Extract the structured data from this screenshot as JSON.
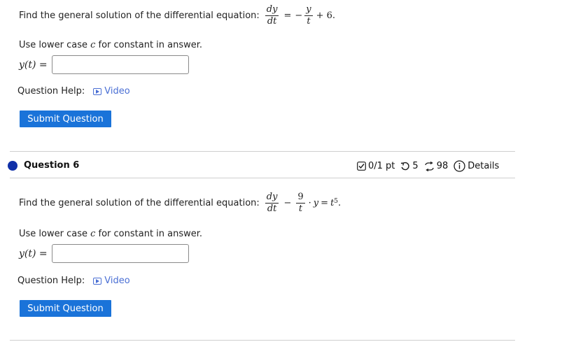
{
  "q5": {
    "prompt": "Find the general solution of the differential equation:",
    "eq": {
      "lhs_num": "dy",
      "lhs_den": "dt",
      "eq": "=",
      "neg": "−",
      "r_num": "y",
      "r_den": "t",
      "tail": "+ 6."
    },
    "instruction_pre": "Use lower case ",
    "instruction_var": "c",
    "instruction_post": " for constant in answer.",
    "answer_label": "y(t) =",
    "answer_value": "",
    "help_label": "Question Help:",
    "video_label": "Video",
    "submit_label": "Submit Question"
  },
  "q6": {
    "title": "Question 6",
    "score": "0/1 pt",
    "retries": "5",
    "attempts": "98",
    "details_label": "Details",
    "prompt": "Find the general solution of the differential equation:",
    "eq": {
      "lhs_num": "dy",
      "lhs_den": "dt",
      "minus": "−",
      "r_num": "9",
      "r_den": "t",
      "dot": "·",
      "y": "y",
      "eq": "=",
      "t": "t",
      "exp": "5",
      "end": "."
    },
    "instruction_pre": "Use lower case ",
    "instruction_var": "c",
    "instruction_post": " for constant in answer.",
    "answer_label": "y(t) =",
    "answer_value": "",
    "help_label": "Question Help:",
    "video_label": "Video",
    "submit_label": "Submit Question"
  },
  "colors": {
    "accent": "#1a73d9",
    "link": "#4a6fd4",
    "dot": "#1030a8"
  },
  "icons": {
    "score": "checkbox-icon",
    "retries": "retry-icon",
    "attempts": "attempts-icon",
    "details": "info-icon",
    "video": "play-icon"
  }
}
